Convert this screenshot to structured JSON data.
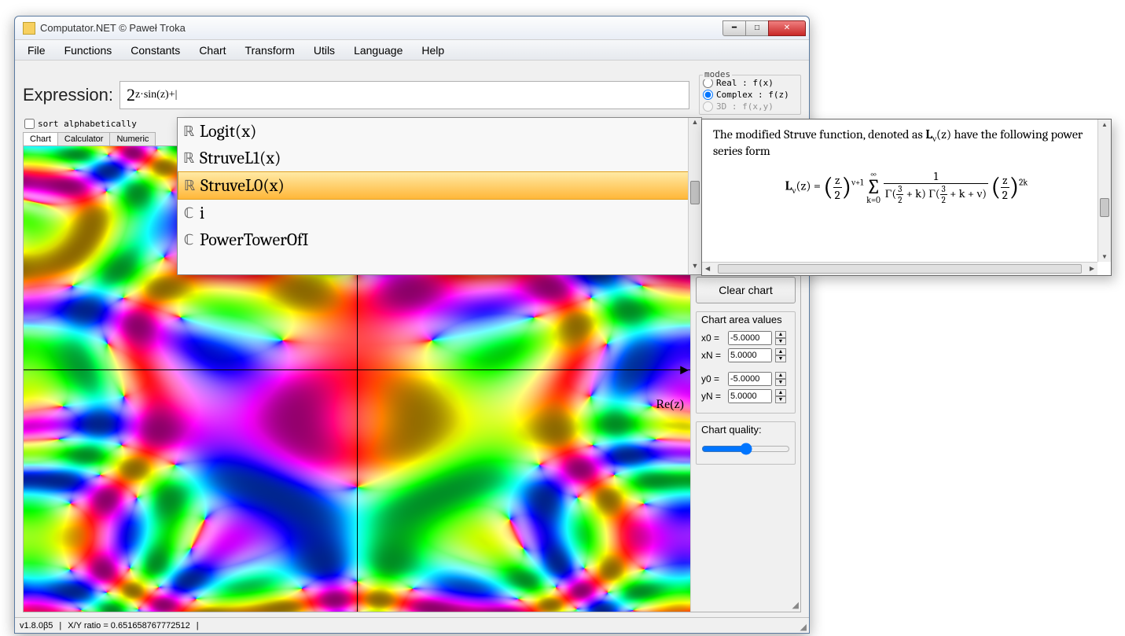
{
  "window": {
    "title": "Computator.NET © Paweł Troka"
  },
  "menu": {
    "file": "File",
    "functions": "Functions",
    "constants": "Constants",
    "chart": "Chart",
    "transform": "Transform",
    "utils": "Utils",
    "language": "Language",
    "help": "Help"
  },
  "expression": {
    "label": "Expression:",
    "value": "2^(z·sin(z))+|"
  },
  "sort_checkbox": {
    "label": "sort alphabetically",
    "checked": false
  },
  "modes": {
    "legend": "modes",
    "real": "Real : f(x)",
    "complex": "Complex : f(z)",
    "threeD": "3D : f(x,y)",
    "selected": "complex"
  },
  "tabs": {
    "chart": "Chart",
    "calculator": "Calculator",
    "numeric": "Numeric",
    "active": "chart"
  },
  "axis_label": "Re(z)",
  "side": {
    "clear": "Clear chart",
    "area_legend": "Chart area values",
    "x0_label": "x0 =",
    "x0": "-5.0000",
    "xN_label": "xN =",
    "xN": "5.0000",
    "y0_label": "y0 =",
    "y0": "-5.0000",
    "yN_label": "yN =",
    "yN": "5.0000",
    "quality_legend": "Chart quality:"
  },
  "status": {
    "version": "v1.8.0β5",
    "ratio_label": "X/Y ratio = 0.651658767772512"
  },
  "autocomplete": {
    "items": [
      {
        "tag": "ℝ",
        "label": "Logit(x)",
        "selected": false
      },
      {
        "tag": "ℝ",
        "label": "StruveL1(x)",
        "selected": false
      },
      {
        "tag": "ℝ",
        "label": "StruveL0(x)",
        "selected": true
      },
      {
        "tag": "ℂ",
        "label": "i",
        "selected": false
      },
      {
        "tag": "ℂ",
        "label": "PowerTowerOfI",
        "selected": false
      }
    ]
  },
  "doc": {
    "text_prefix": "The modified Struve function, denoted as ",
    "symbol": "L",
    "sub": "ν",
    "arg": "(z)",
    "text_suffix": " have the following power series form"
  }
}
